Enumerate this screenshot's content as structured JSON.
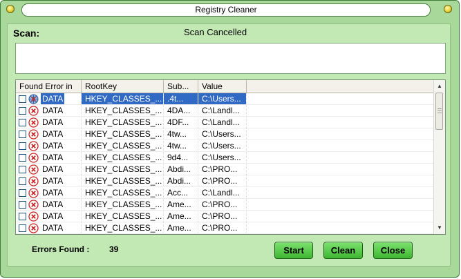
{
  "window": {
    "title": "Registry Cleaner"
  },
  "scan": {
    "label": "Scan:",
    "status": "Scan Cancelled",
    "log_text": ""
  },
  "list": {
    "columns": [
      "Found Error in",
      "RootKey",
      "Sub...",
      "Value"
    ],
    "rows": [
      {
        "found": "DATA",
        "rootkey": "HKEY_CLASSES_...",
        "sub": ".4t...",
        "value": "C:\\Users...",
        "selected": true
      },
      {
        "found": "DATA",
        "rootkey": "HKEY_CLASSES_...",
        "sub": "4DA...",
        "value": "C:\\Landl..."
      },
      {
        "found": "DATA",
        "rootkey": "HKEY_CLASSES_...",
        "sub": "4DF...",
        "value": "C:\\Landl..."
      },
      {
        "found": "DATA",
        "rootkey": "HKEY_CLASSES_...",
        "sub": "4tw...",
        "value": "C:\\Users..."
      },
      {
        "found": "DATA",
        "rootkey": "HKEY_CLASSES_...",
        "sub": "4tw...",
        "value": "C:\\Users..."
      },
      {
        "found": "DATA",
        "rootkey": "HKEY_CLASSES_...",
        "sub": "9d4...",
        "value": "C:\\Users..."
      },
      {
        "found": "DATA",
        "rootkey": "HKEY_CLASSES_...",
        "sub": "Abdi...",
        "value": "C:\\PRO..."
      },
      {
        "found": "DATA",
        "rootkey": "HKEY_CLASSES_...",
        "sub": "Abdi...",
        "value": "C:\\PRO..."
      },
      {
        "found": "DATA",
        "rootkey": "HKEY_CLASSES_...",
        "sub": "Acc...",
        "value": "C:\\Landl..."
      },
      {
        "found": "DATA",
        "rootkey": "HKEY_CLASSES_...",
        "sub": "Ame...",
        "value": "C:\\PRO..."
      },
      {
        "found": "DATA",
        "rootkey": "HKEY_CLASSES_...",
        "sub": "Ame...",
        "value": "C:\\PRO..."
      },
      {
        "found": "DATA",
        "rootkey": "HKEY_CLASSES_...",
        "sub": "Ame...",
        "value": "C:\\PRO..."
      }
    ]
  },
  "footer": {
    "errors_label": "Errors Found :",
    "errors_count": "39"
  },
  "buttons": {
    "start": "Start",
    "clean": "Clean",
    "close": "Close"
  },
  "icons": {
    "row_error": "error-x-icon",
    "row_error_selected": "error-globe-icon",
    "title_orb": "orb-icon"
  },
  "colors": {
    "window_bg": "#a8d89a",
    "panel_bg": "#c2e8b3",
    "button": "#4fc442",
    "selection": "#316ac5",
    "error_red": "#cc2222"
  }
}
